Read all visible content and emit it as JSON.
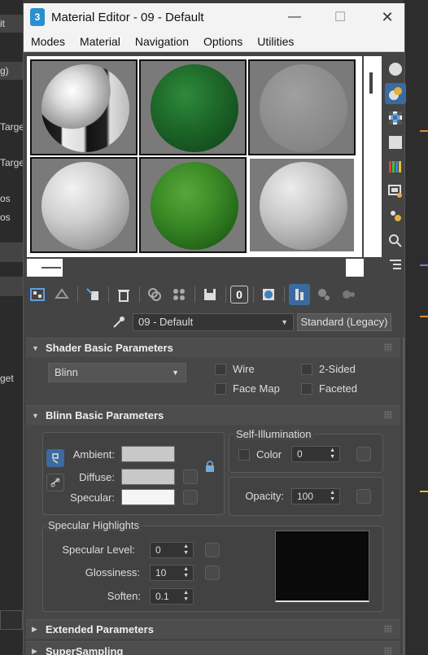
{
  "background_app": {
    "left_fragments": [
      "it",
      "g)",
      "Targe",
      "Targe",
      "os",
      "os",
      "get"
    ]
  },
  "window": {
    "app_icon_text": "3",
    "title": "Material Editor - 09 - Default",
    "minimize": "—",
    "maximize": "☐",
    "close": "✕"
  },
  "menu": [
    "Modes",
    "Material",
    "Navigation",
    "Options",
    "Utilities"
  ],
  "material": {
    "name": "09 - Default",
    "type": "Standard (Legacy)"
  },
  "shader_basic": {
    "title": "Shader Basic Parameters",
    "shader": "Blinn",
    "wire": "Wire",
    "two_sided": "2-Sided",
    "face_map": "Face Map",
    "faceted": "Faceted"
  },
  "blinn_basic": {
    "title": "Blinn Basic Parameters",
    "ambient_label": "Ambient:",
    "diffuse_label": "Diffuse:",
    "specular_label": "Specular:",
    "ambient_color": "#c8c8c8",
    "diffuse_color": "#c8c8c8",
    "specular_color": "#f5f5f5",
    "self_illum_title": "Self-Illumination",
    "color_label": "Color",
    "self_illum_value": "0",
    "opacity_label": "Opacity:",
    "opacity_value": "100",
    "spec_highlights_title": "Specular Highlights",
    "specular_level_label": "Specular Level:",
    "specular_level_value": "0",
    "glossiness_label": "Glossiness:",
    "glossiness_value": "10",
    "soften_label": "Soften:",
    "soften_value": "0.1"
  },
  "extended": {
    "title": "Extended Parameters"
  },
  "supersampling": {
    "title": "SuperSampling"
  },
  "toolbar": {
    "id_value": "0"
  },
  "colors": {
    "accent": "#3b6aa0",
    "panel": "#444444"
  }
}
